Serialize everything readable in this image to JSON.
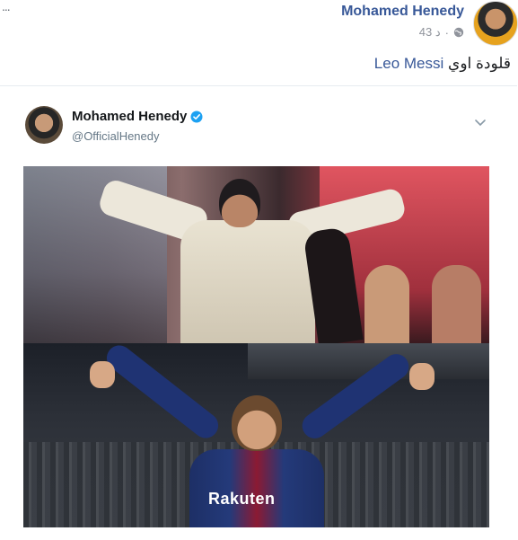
{
  "fb_post": {
    "more_dots": "...",
    "author_name": "Mohamed Henedy",
    "timestamp": "43 د",
    "separator": "·",
    "text_prefix": "قلودة اوي",
    "text_link": "Leo Messi"
  },
  "tweet": {
    "name": "Mohamed Henedy",
    "handle": "@OfficialHenedy"
  },
  "media": {
    "sponsor_text": "Rakuten"
  },
  "colors": {
    "fb_link": "#385898",
    "twitter_verified": "#1da1f2",
    "meta_gray": "#90949c"
  },
  "icons": [
    "globe-icon",
    "verified-icon",
    "chevron-down-icon"
  ]
}
